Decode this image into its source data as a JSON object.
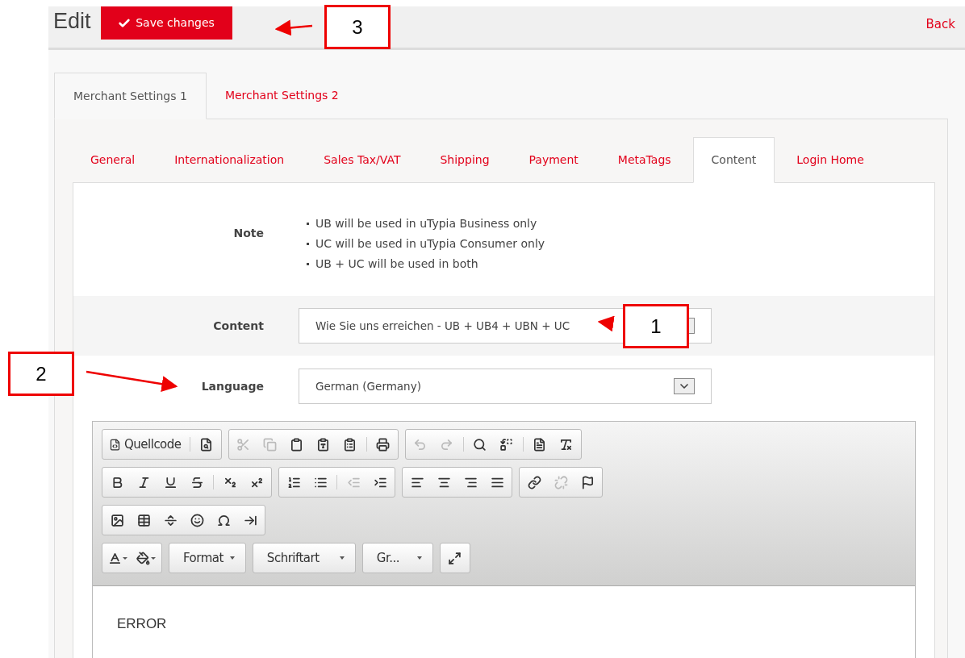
{
  "header": {
    "title": "Edit",
    "save_button": "Save changes",
    "back_link": "Back"
  },
  "outer_tabs": [
    {
      "label": "Merchant Settings 1",
      "selected": true
    },
    {
      "label": "Merchant Settings 2",
      "selected": false
    }
  ],
  "inner_tabs": [
    {
      "label": "General",
      "selected": false
    },
    {
      "label": "Internationalization",
      "selected": false
    },
    {
      "label": "Sales Tax/VAT",
      "selected": false
    },
    {
      "label": "Shipping",
      "selected": false
    },
    {
      "label": "Payment",
      "selected": false
    },
    {
      "label": "MetaTags",
      "selected": false
    },
    {
      "label": "Content",
      "selected": true
    },
    {
      "label": "Login Home",
      "selected": false
    }
  ],
  "note": {
    "label": "Note",
    "items": [
      "UB will be used in uTypia Business only",
      "UC will be used in uTypia Consumer only",
      "UB + UC will be used in both"
    ]
  },
  "content_field": {
    "label": "Content",
    "value": "Wie Sie uns erreichen - UB + UB4 + UBN + UC"
  },
  "language_field": {
    "label": "Language",
    "value": "German (Germany)"
  },
  "editor": {
    "toolbar": [
      [
        [
          {
            "kind": "text-button",
            "label": "Quellcode",
            "disabled": false
          },
          {
            "kind": "separator"
          },
          {
            "kind": "icon",
            "disabled": false
          }
        ],
        [
          {
            "kind": "icon",
            "disabled": true
          },
          {
            "kind": "icon",
            "disabled": true
          },
          {
            "kind": "icon",
            "disabled": false
          },
          {
            "kind": "icon",
            "disabled": false
          },
          {
            "kind": "icon",
            "disabled": false
          },
          {
            "kind": "separator"
          },
          {
            "kind": "icon",
            "disabled": false
          }
        ],
        [
          {
            "kind": "icon",
            "disabled": true
          },
          {
            "kind": "icon",
            "disabled": true
          },
          {
            "kind": "separator"
          },
          {
            "kind": "icon",
            "disabled": false
          },
          {
            "kind": "icon",
            "disabled": false
          },
          {
            "kind": "separator"
          },
          {
            "kind": "icon",
            "disabled": false
          },
          {
            "kind": "icon",
            "disabled": false
          }
        ]
      ],
      [
        [
          {
            "kind": "icon",
            "disabled": false
          },
          {
            "kind": "icon",
            "disabled": false
          },
          {
            "kind": "icon",
            "disabled": false
          },
          {
            "kind": "icon",
            "disabled": false
          },
          {
            "kind": "separator"
          },
          {
            "kind": "icon",
            "disabled": false
          },
          {
            "kind": "icon",
            "disabled": false
          }
        ],
        [
          {
            "kind": "icon",
            "disabled": false
          },
          {
            "kind": "icon",
            "disabled": false
          },
          {
            "kind": "separator"
          },
          {
            "kind": "icon",
            "disabled": true
          },
          {
            "kind": "icon",
            "disabled": false
          }
        ],
        [
          {
            "kind": "icon",
            "disabled": false
          },
          {
            "kind": "icon",
            "disabled": false
          },
          {
            "kind": "icon",
            "disabled": false
          },
          {
            "kind": "icon",
            "disabled": false
          }
        ],
        [
          {
            "kind": "icon",
            "disabled": false
          },
          {
            "kind": "icon",
            "disabled": true
          },
          {
            "kind": "icon",
            "disabled": false
          }
        ]
      ],
      [
        [
          {
            "kind": "icon",
            "disabled": false
          },
          {
            "kind": "icon",
            "disabled": false
          },
          {
            "kind": "icon",
            "disabled": false
          },
          {
            "kind": "icon",
            "disabled": false
          },
          {
            "kind": "icon",
            "disabled": false
          },
          {
            "kind": "icon",
            "disabled": false
          }
        ]
      ],
      [
        [
          {
            "kind": "color-button",
            "disabled": false
          },
          {
            "kind": "color-button",
            "disabled": false
          }
        ],
        [
          {
            "kind": "dropdown",
            "label": "Format",
            "disabled": false
          }
        ],
        [
          {
            "kind": "dropdown",
            "label": "Schriftart",
            "disabled": false
          }
        ],
        [
          {
            "kind": "dropdown",
            "label": "Gr...",
            "disabled": false
          }
        ],
        [
          {
            "kind": "icon",
            "disabled": false
          }
        ]
      ]
    ],
    "body_text": "ERROR"
  },
  "annotations": [
    {
      "label": "3"
    },
    {
      "label": "1"
    },
    {
      "label": "2"
    }
  ]
}
